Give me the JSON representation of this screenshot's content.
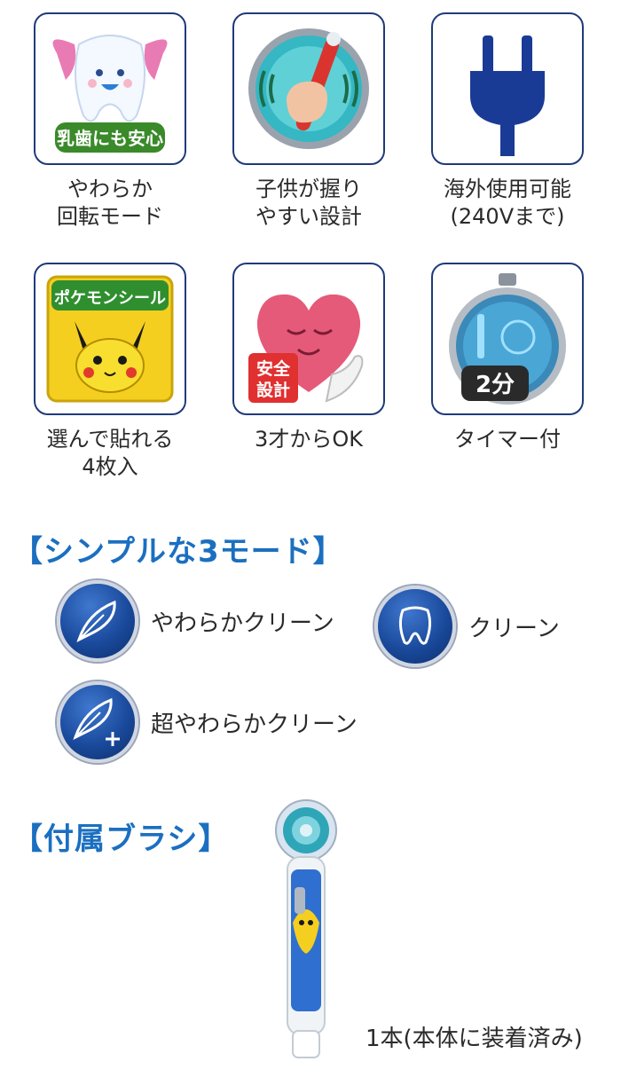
{
  "features": [
    {
      "id": "gentle",
      "badge": "乳歯にも安心",
      "caption_line1": "やわらか",
      "caption_line2": "回転モード",
      "icon": "tooth-wings-icon"
    },
    {
      "id": "grip",
      "caption_line1": "子供が握り",
      "caption_line2": "やすい設計",
      "icon": "hand-holding-brush-icon"
    },
    {
      "id": "voltage",
      "caption_line1": "海外使用可能",
      "caption_line2": "(240Vまで)",
      "icon": "power-plug-icon"
    },
    {
      "id": "stickers",
      "badge": "ポケモンシール",
      "caption_line1": "選んで貼れる",
      "caption_line2": "4枚入",
      "icon": "pokemon-sticker-icon"
    },
    {
      "id": "safety",
      "badge_line1": "安全",
      "badge_line2": "設計",
      "caption_line1": "3才からOK",
      "icon": "heart-hand-icon"
    },
    {
      "id": "timer",
      "badge": "2分",
      "caption_line1": "タイマー付",
      "icon": "stopwatch-icon"
    }
  ],
  "modes_section": {
    "title": "【シンプルな3モード】",
    "modes": [
      {
        "label": "やわらかクリーン",
        "icon": "feather-icon"
      },
      {
        "label": "クリーン",
        "icon": "tooth-icon"
      },
      {
        "label": "超やわらかクリーン",
        "icon": "feather-plus-icon"
      }
    ]
  },
  "brush_section": {
    "title": "【付属ブラシ】",
    "included_text": "1本(本体に装着済み)"
  },
  "colors": {
    "accent": "#1b6fc0",
    "border": "#1f3a7a",
    "mode_bg": "#1a4a9c"
  }
}
